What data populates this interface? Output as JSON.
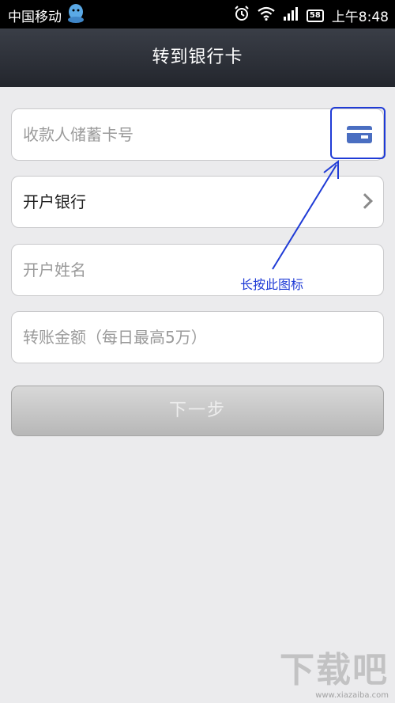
{
  "status_bar": {
    "carrier": "中国移动",
    "battery": "58",
    "time": "上午8:48"
  },
  "header": {
    "title": "转到银行卡"
  },
  "form": {
    "card_number_placeholder": "收款人储蓄卡号",
    "bank_label": "开户银行",
    "name_placeholder": "开户姓名",
    "amount_placeholder": "转账金额（每日最高5万）",
    "next_button": "下一步"
  },
  "annotation": {
    "label": "长按此图标"
  },
  "watermark": {
    "logo": "下载吧",
    "url": "www.xiazaiba.com"
  },
  "icons": {
    "card_scan": "credit-card-icon",
    "bank_arrow": "chevron-right-icon",
    "qq": "qq-penguin-icon",
    "alarm": "alarm-icon",
    "wifi": "wifi-icon",
    "signal": "signal-icon"
  },
  "colors": {
    "annotation": "#1f3bd6",
    "card_icon": "#4a6ec1",
    "header": "#2b2e35"
  }
}
